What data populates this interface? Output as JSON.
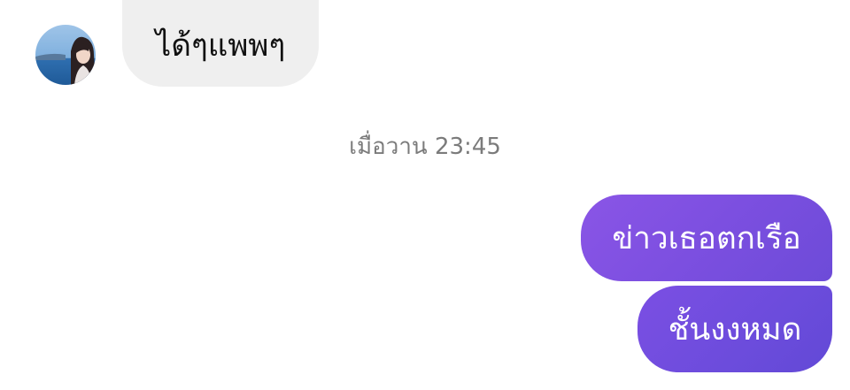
{
  "thread": {
    "incoming": [
      {
        "text": "ได้ๆแพพๆ"
      }
    ],
    "timestamp": "เมื่อวาน 23:45",
    "outgoing": [
      {
        "text": "ข่าวเธอตกเรือ"
      },
      {
        "text": "ชั้นงงหมด"
      }
    ]
  },
  "colors": {
    "incoming_bubble": "#efefef",
    "outgoing_bubble": "#7c4fe0",
    "timestamp_text": "#7b7b7b"
  },
  "icons": {
    "avatar": "contact-avatar-photo"
  }
}
